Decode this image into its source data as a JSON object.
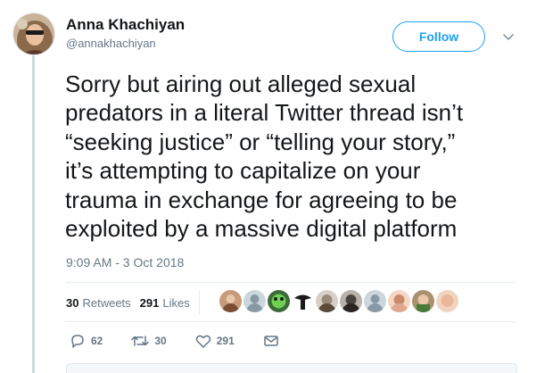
{
  "tweet": {
    "author_name": "Anna Khachiyan",
    "author_handle": "@annakhachiyan",
    "follow_label": "Follow",
    "text": "Sorry but airing out alleged sexual\npredators in a literal Twitter thread isn’t\n“seeking justice” or “telling your story,”\nit’s attempting to capitalize on your\ntrauma in exchange for agreeing to be\nexploited by a massive digital platform",
    "timestamp": "9:09 AM - 3 Oct 2018"
  },
  "stats": {
    "retweets_count": "30",
    "retweets_label": "Retweets",
    "likes_count": "291",
    "likes_label": "Likes"
  },
  "actions": {
    "reply_count": "62",
    "retweet_count": "30",
    "like_count": "291"
  },
  "icons": {
    "reply": "reply-icon",
    "retweet": "retweet-icon",
    "like": "heart-icon",
    "dm": "envelope-icon",
    "caret": "chevron-down-icon"
  },
  "colors": {
    "accent": "#1da1f2",
    "text": "#14171a",
    "muted": "#657786",
    "divider": "#e6ecf0"
  },
  "likers_count": 10
}
